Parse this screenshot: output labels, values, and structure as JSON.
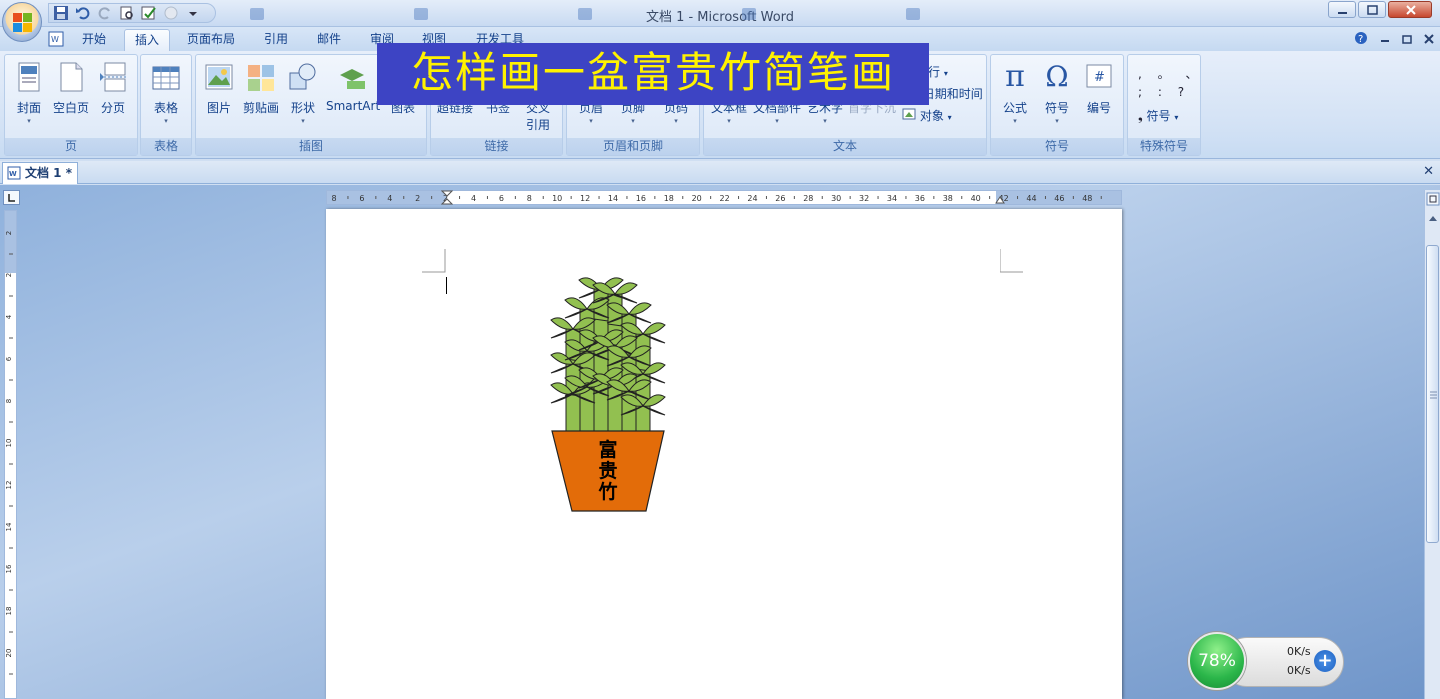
{
  "window": {
    "title": "文档 1 - Microsoft Word"
  },
  "tabs": [
    {
      "label": "开始"
    },
    {
      "label": "插入"
    },
    {
      "label": "页面布局"
    },
    {
      "label": "引用"
    },
    {
      "label": "邮件"
    },
    {
      "label": "审阅"
    },
    {
      "label": "视图"
    },
    {
      "label": "开发工具"
    }
  ],
  "ribbon": {
    "pages": {
      "group": "页",
      "cover": "封面",
      "blank": "空白页",
      "break": "分页"
    },
    "tables": {
      "group": "表格",
      "table": "表格"
    },
    "illustrations": {
      "group": "插图",
      "picture": "图片",
      "clipart": "剪贴画",
      "shapes": "形状",
      "smartart": "SmartArt",
      "chart": "图表"
    },
    "links": {
      "group": "链接",
      "hyperlink": "超链接",
      "bookmark": "书签",
      "crossref_1": "交叉",
      "crossref_2": "引用"
    },
    "header_footer": {
      "group": "页眉和页脚",
      "header": "页眉",
      "footer": "页脚",
      "page_number": "页码"
    },
    "text": {
      "group": "文本",
      "textbox": "文本框",
      "quickparts": "文档部件",
      "wordart": "艺术字",
      "dropcap": "首字下沉",
      "signature": "签名行",
      "datetime": "日期和时间",
      "object": "对象"
    },
    "symbols": {
      "group": "符号",
      "equation": "公式",
      "symbol": "符号",
      "number": "编号"
    },
    "special": {
      "group": "特殊符号",
      "row1": ",  。  、",
      "row2": ";  :  ?",
      "symbol": "符号"
    }
  },
  "overlay_title": "怎样画一盆富贵竹简笔画",
  "document": {
    "tab_label": "文档 1 *",
    "pot_label_1": "富",
    "pot_label_2": "贵",
    "pot_label_3": "竹"
  },
  "ruler": {
    "h_labels": [
      "8",
      "6",
      "4",
      "2",
      "2",
      "4",
      "6",
      "8",
      "10",
      "12",
      "14",
      "16",
      "18",
      "20",
      "22",
      "24",
      "26",
      "28",
      "30",
      "32",
      "34",
      "36",
      "38",
      "40",
      "42",
      "44",
      "46",
      "48"
    ],
    "v_labels": [
      "2",
      "2",
      "4",
      "6",
      "8",
      "10",
      "12",
      "14",
      "16",
      "18",
      "20"
    ]
  },
  "net_widget": {
    "percent": "78%",
    "up": "0K/s",
    "down": "0K/s"
  },
  "colors": {
    "overlay_bg": "#3d44c4",
    "overlay_text": "#fff200",
    "pot": "#e36c09",
    "bamboo": "#92c050"
  }
}
